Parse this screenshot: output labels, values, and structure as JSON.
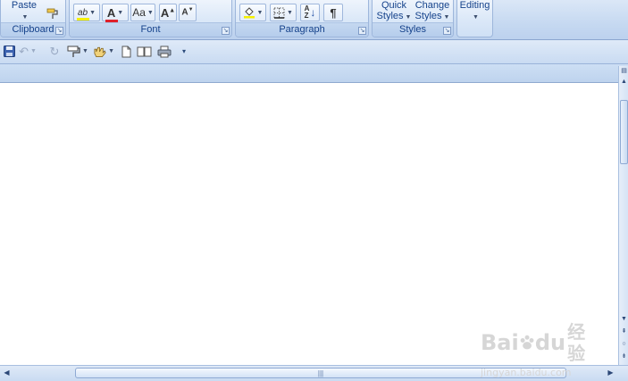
{
  "ribbon": {
    "clipboard": {
      "paste_label": "Paste",
      "group_label": "Clipboard"
    },
    "font": {
      "group_label": "Font",
      "highlight_glyph": "ab",
      "font_color_glyph": "A",
      "change_case_glyph": "Aa",
      "grow_glyph": "A",
      "shrink_glyph": "A"
    },
    "paragraph": {
      "group_label": "Paragraph",
      "pilcrow_glyph": "¶",
      "sort_top": "A",
      "sort_bottom": "Z"
    },
    "styles": {
      "group_label": "Styles",
      "quick_1": "Quick",
      "quick_2": "Styles",
      "change_1": "Change",
      "change_2": "Styles"
    },
    "editing": {
      "label": "Editing"
    }
  },
  "colors": {
    "font_color_bar": "#e0202a",
    "highlight_bar": "#f5f000",
    "ribbon_bg": "#c6d9f1"
  },
  "qat": {
    "icons": [
      "save-icon",
      "undo-icon",
      "redo-icon",
      "format-painter-icon",
      "hand-icon",
      "new-document-icon",
      "open-book-icon",
      "print-icon",
      "customize-icon"
    ]
  },
  "watermark": {
    "brand": "Bai",
    "brand2": "du",
    "cn": "经验",
    "url": "jingyan.baidu.com"
  }
}
